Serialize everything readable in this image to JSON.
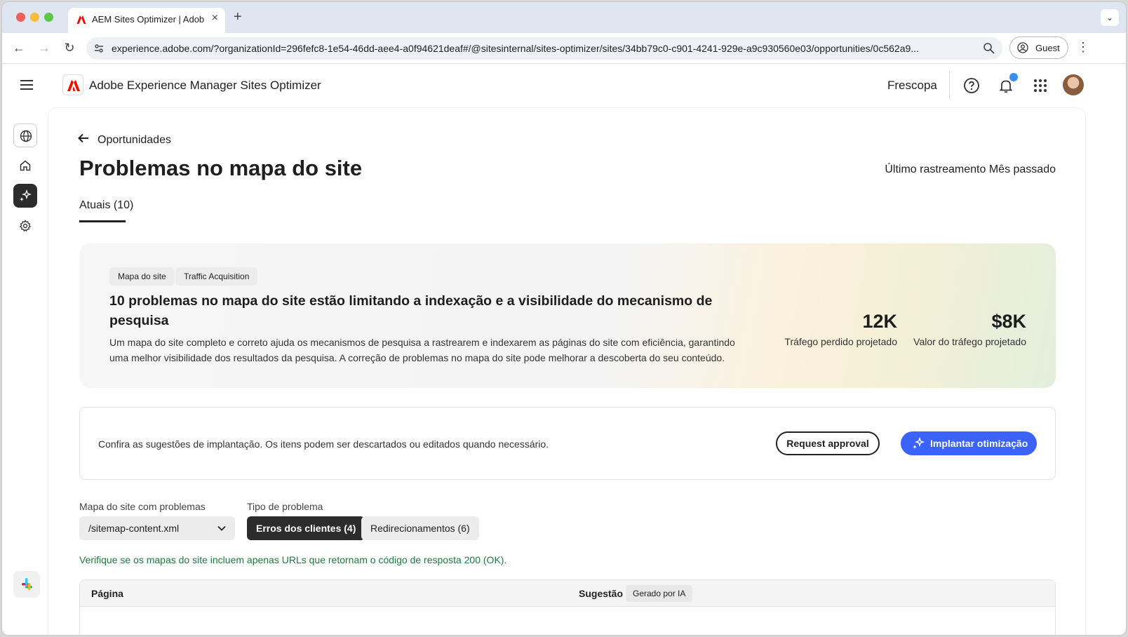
{
  "browser": {
    "tab_title": "AEM Sites Optimizer | Adobe",
    "url": "experience.adobe.com/?organizationId=296fefc8-1e54-46dd-aee4-a0f94621deaf#/@sitesinternal/sites-optimizer/sites/34bb79c0-c901-4241-929e-a9c930560e03/opportunities/0c562a9...",
    "profile_label": "Guest"
  },
  "header": {
    "app_title": "Adobe Experience Manager Sites Optimizer",
    "org": "Frescopa"
  },
  "page": {
    "back_label": "Oportunidades",
    "title": "Problemas no mapa do site",
    "last_crawl": "Último rastreamento Mês passado",
    "tab_current": "Atuais (10)"
  },
  "hero": {
    "chips": [
      "Mapa do site",
      "Traffic Acquisition"
    ],
    "title": "10 problemas no mapa do site estão limitando a indexação e a visibilidade do mecanismo de pesquisa",
    "description": "Um mapa do site completo e correto ajuda os mecanismos de pesquisa a rastrearem e indexarem as páginas do site com eficiência, garantindo uma melhor visibilidade dos resultados da pesquisa. A correção de problemas no mapa do site pode melhorar a descoberta do seu conteúdo.",
    "metrics": [
      {
        "value": "12K",
        "label": "Tráfego perdido projetado"
      },
      {
        "value": "$8K",
        "label": "Valor do tráfego projetado"
      }
    ]
  },
  "deploy": {
    "text": "Confira as sugestões de implantação. Os itens podem ser descartados ou editados quando necessário.",
    "request_label": "Request approval",
    "deploy_label": "Implantar otimização"
  },
  "filters": {
    "sitemap_label": "Mapa do site com problemas",
    "sitemap_value": "/sitemap-content.xml",
    "type_label": "Tipo de problema",
    "types": [
      {
        "label": "Erros dos clientes (4)",
        "active": true
      },
      {
        "label": "Redirecionamentos (6)",
        "active": false
      }
    ],
    "hint": "Verifique se os mapas do site incluem apenas URLs que retornam o código de resposta 200 (OK)."
  },
  "table": {
    "col_page": "Página",
    "col_suggestion": "Sugestão",
    "ai_badge": "Gerado por IA"
  },
  "colors": {
    "accent": "#3b63fb",
    "hint_green": "#1f7a3e",
    "adobe_red": "#eb1000"
  }
}
